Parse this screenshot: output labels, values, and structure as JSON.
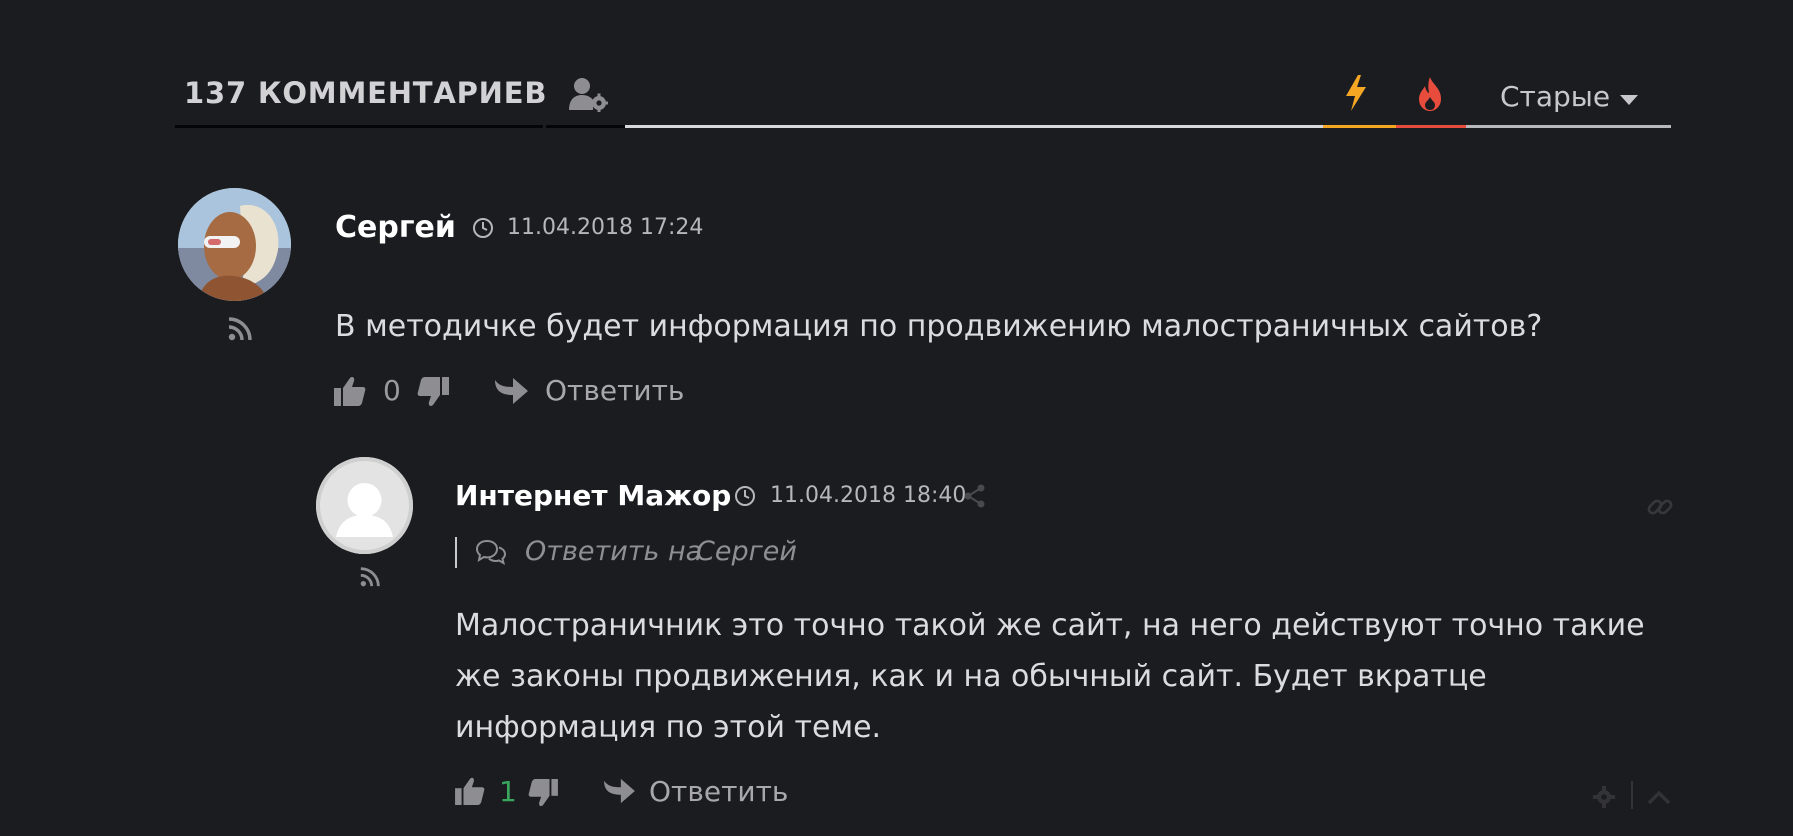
{
  "header": {
    "count_label": "137 КОММЕНТАРИЕВ",
    "sort_label": "Старые",
    "colors": {
      "accent_orange": "#f5a623",
      "accent_red": "#e74c3c"
    }
  },
  "comments": [
    {
      "author": "Сергей",
      "date": "11.04.2018 17:24",
      "text": "В методичке будет информация по продвижению малостраничных сайтов?",
      "votes": "0",
      "reply_label": "Ответить"
    },
    {
      "author": "Интернет Мажор",
      "date": "11.04.2018 18:40",
      "reply_to_prefix": "Ответить на",
      "reply_to_name": "Сергей",
      "text": "Малостраничник это точно такой же сайт, на него действуют точно такие же законы продвижения, как и на обычный сайт. Будет вкратце информация по этой теме.",
      "votes": "1",
      "reply_label": "Ответить"
    }
  ],
  "icons": [
    "user-settings-icon",
    "lightning-icon",
    "fire-icon",
    "caret-down-icon",
    "clock-icon",
    "rss-icon",
    "thumbs-up-icon",
    "thumbs-down-icon",
    "reply-arrow-icon",
    "share-icon",
    "link-icon",
    "comments-icon",
    "gear-icon",
    "chevron-up-icon"
  ]
}
